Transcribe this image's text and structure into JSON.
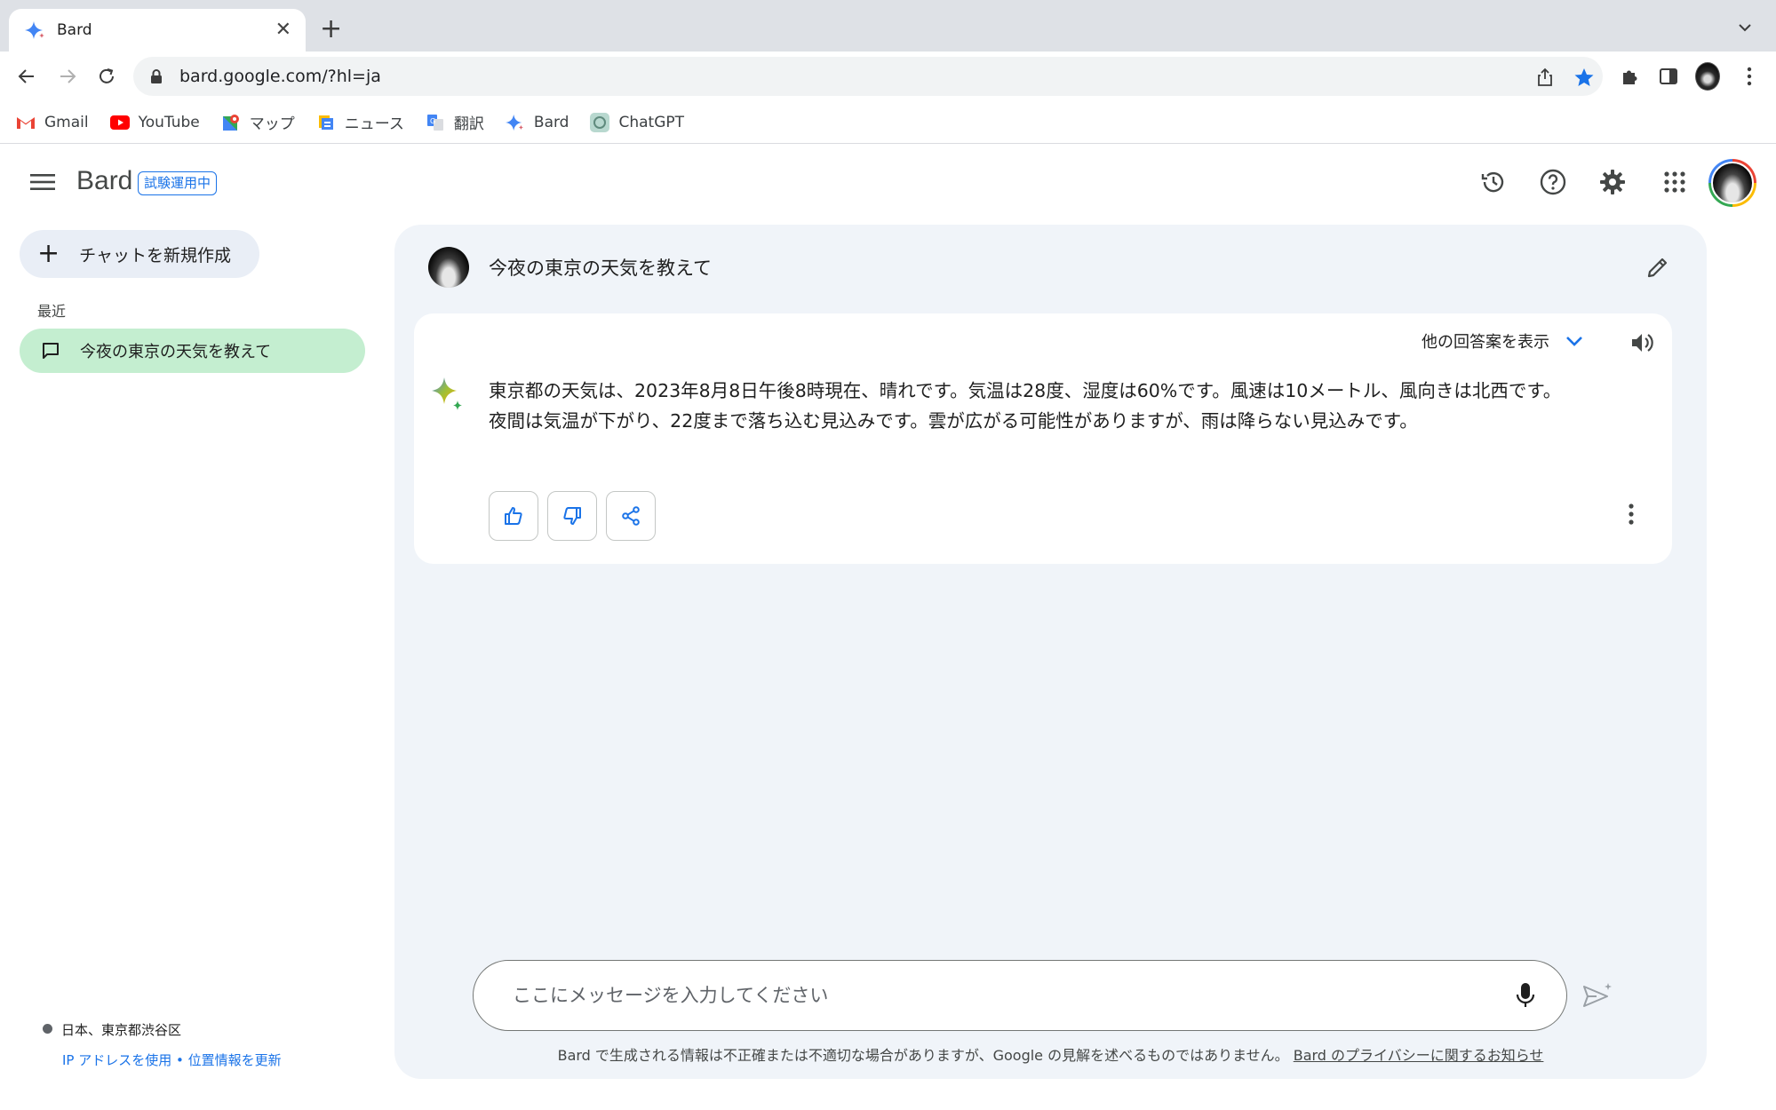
{
  "browser": {
    "tab_title": "Bard",
    "url": "bard.google.com/?hl=ja",
    "bookmarks": [
      {
        "label": "Gmail",
        "icon": "gmail-icon"
      },
      {
        "label": "YouTube",
        "icon": "youtube-icon"
      },
      {
        "label": "マップ",
        "icon": "maps-icon"
      },
      {
        "label": "ニュース",
        "icon": "news-icon"
      },
      {
        "label": "翻訳",
        "icon": "translate-icon"
      },
      {
        "label": "Bard",
        "icon": "bard-icon"
      },
      {
        "label": "ChatGPT",
        "icon": "chatgpt-icon"
      }
    ]
  },
  "app": {
    "brand": "Bard",
    "badge": "試験運用中"
  },
  "sidebar": {
    "new_chat": "チャットを新規作成",
    "recent_label": "最近",
    "recent_items": [
      {
        "label": "今夜の東京の天気を教えて"
      }
    ],
    "location": "日本、東京都渋谷区",
    "ip_link": "IP アドレスを使用",
    "separator": " • ",
    "update_link": "位置情報を更新"
  },
  "conversation": {
    "question": "今夜の東京の天気を教えて",
    "drafts_label": "他の回答案を表示",
    "answer_line1": "東京都の天気は、2023年8月8日午後8時現在、晴れです。気温は28度、湿度は60%です。風速は10メートル、風向きは北西です。",
    "answer_line2": "夜間は気温が下がり、22度まで落ち込む見込みです。雲が広がる可能性がありますが、雨は降らない見込みです。"
  },
  "input": {
    "placeholder": "ここにメッセージを入力してください"
  },
  "footer": {
    "disclaimer": "Bard で生成される情報は不正確または不適切な場合がありますが、Google の見解を述べるものではありません。",
    "privacy_link": "Bard のプライバシーに関するお知らせ"
  },
  "colors": {
    "accent": "#1a73e8",
    "main_bg": "#f0f4f9",
    "recent_selected": "#c4eed0",
    "new_chat_bg": "#e9eef6"
  }
}
